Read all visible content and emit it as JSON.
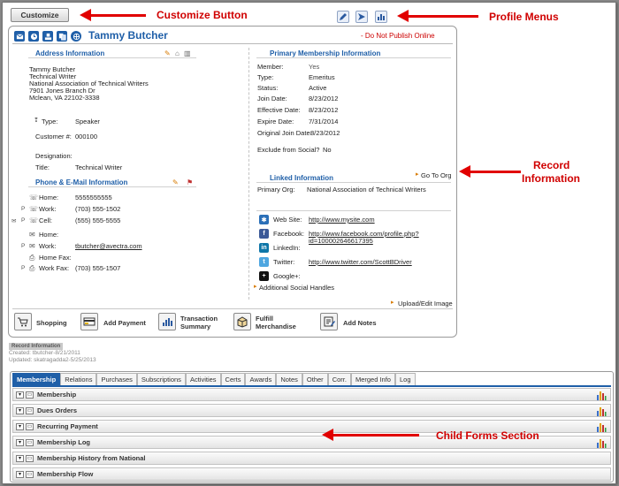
{
  "toolbar": {
    "customize_label": "Customize",
    "profile_menus_icons": [
      "edit-pencil-icon",
      "send-icon",
      "reports-icon"
    ]
  },
  "annotations": {
    "customize_button": "Customize Button",
    "profile_menus": "Profile Menus",
    "record_information_line1": "Record",
    "record_information_line2": "Information",
    "child_forms": "Child Forms Section",
    "arrow_color": "#e10000"
  },
  "profile": {
    "name": "Tammy Butcher",
    "do_not_publish": "- Do Not Publish Online",
    "header_icons": [
      "mail-icon",
      "clock-icon",
      "stamp-icon",
      "copy-icon",
      "globe-icon"
    ],
    "accent_color": "#1f5fa8",
    "address": {
      "title": "Address Information",
      "lines": [
        "Tammy Butcher",
        "Technical Writer",
        "National Association of Technical Writers",
        "7901 Jones Branch Dr",
        "Mclean, VA 22102-3338"
      ],
      "type_label": "Type:",
      "type_value": "Speaker",
      "customer_label": "Customer #:",
      "customer_value": "000100",
      "designation_label": "Designation:",
      "designation_value": "",
      "title_label": "Title:",
      "title_value": "Technical Writer"
    },
    "phone_email": {
      "title": "Phone & E-Mail Information",
      "rows": [
        {
          "label": "Home:",
          "value": "5555555555"
        },
        {
          "label": "Work:",
          "value": "(703) 555-1502"
        },
        {
          "label": "Cell:",
          "value": "(555) 555-5555"
        },
        {
          "label": "Home:",
          "value": ""
        },
        {
          "label": "Work:",
          "value": "tbutcher@avectra.com"
        },
        {
          "label": "Home Fax:",
          "value": ""
        },
        {
          "label": "Work Fax:",
          "value": "(703) 555-1507"
        }
      ]
    },
    "membership": {
      "title": "Primary Membership Information",
      "rows": [
        {
          "label": "Member:",
          "value": "Yes"
        },
        {
          "label": "Type:",
          "value": "Emeritus"
        },
        {
          "label": "Status:",
          "value": "Active"
        },
        {
          "label": "Join Date:",
          "value": "8/23/2012"
        },
        {
          "label": "Effective Date:",
          "value": "8/23/2012"
        },
        {
          "label": "Expire Date:",
          "value": "7/31/2014"
        },
        {
          "label": "Original Join Date:",
          "value": "8/23/2012"
        }
      ],
      "exclude_label": "Exclude from Social?",
      "exclude_value": "No"
    },
    "linked": {
      "title": "Linked Information",
      "go_to_org": "Go To Org",
      "primary_org_label": "Primary Org:",
      "primary_org_value": "National Association of Technical Writers"
    },
    "social": {
      "rows": [
        {
          "label": "Web Site:",
          "value": "http://www.mysite.com",
          "value2": ""
        },
        {
          "label": "Facebook:",
          "value": "http://www.facebook.com/profile.php?",
          "value2": "id=100002646617395"
        },
        {
          "label": "LinkedIn:",
          "value": "",
          "value2": ""
        },
        {
          "label": "Twitter:",
          "value": "http://www.twitter.com/ScottBDriver",
          "value2": ""
        },
        {
          "label": "Google+:",
          "value": "",
          "value2": ""
        }
      ],
      "additional": "Additional Social Handles",
      "upload": "Upload/Edit Image"
    },
    "actions": [
      {
        "label": "Shopping",
        "label2": ""
      },
      {
        "label": "Add Payment",
        "label2": ""
      },
      {
        "label": "Transaction",
        "label2": "Summary"
      },
      {
        "label": "Fulfill",
        "label2": "Merchandise"
      },
      {
        "label": "Add Notes",
        "label2": ""
      }
    ]
  },
  "record_info": {
    "tab_label": "Record Information",
    "created": "Created: tbutcher-8/21/2011",
    "updated": "Updated: skatragadda2-5/25/2013"
  },
  "child_tabs": [
    "Membership",
    "Relations",
    "Purchases",
    "Subscriptions",
    "Activities",
    "Certs",
    "Awards",
    "Notes",
    "Other",
    "Corr.",
    "Merged Info",
    "Log"
  ],
  "child_tabs_active": "Membership",
  "child_forms": [
    "Membership",
    "Dues Orders",
    "Recurring Payment",
    "Membership Log",
    "Membership History from National",
    "Membership Flow"
  ]
}
